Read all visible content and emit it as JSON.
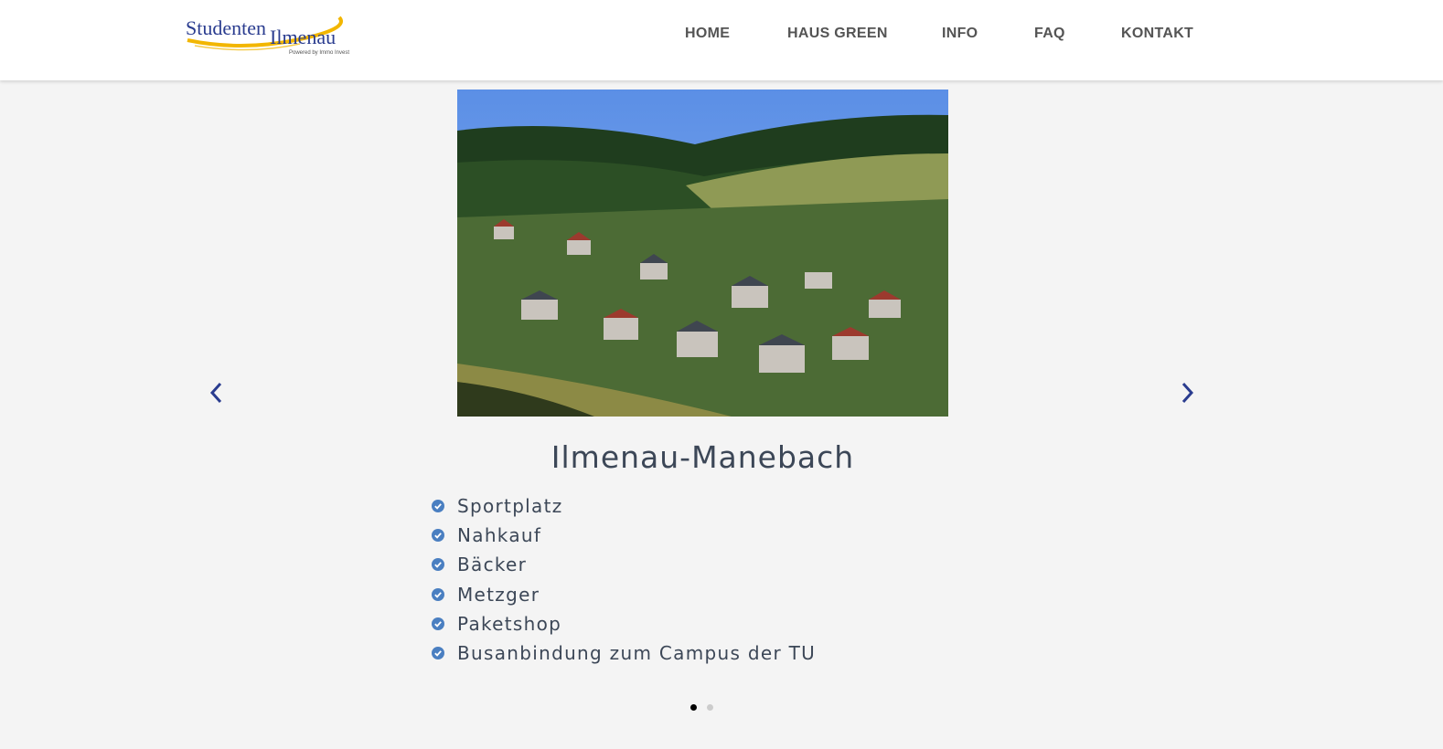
{
  "header": {
    "logo": {
      "wordmark_left": "Studenten",
      "wordmark_right": "Ilmenau",
      "tagline": "Powered by Immo Invest"
    },
    "nav": [
      {
        "label": "HOME"
      },
      {
        "label": "HAUS GREEN"
      },
      {
        "label": "INFO"
      },
      {
        "label": "FAQ"
      },
      {
        "label": "KONTAKT"
      }
    ]
  },
  "slider": {
    "image_icon": "landscape-photo",
    "title": "Ilmenau-Manebach",
    "features": [
      "Sportplatz",
      "Nahkauf",
      "Bäcker",
      "Metzger",
      "Paketshop",
      "Busanbindung zum Campus der TU"
    ],
    "prev_icon": "chevron-left-icon",
    "next_icon": "chevron-right-icon",
    "active_slide_index": 0,
    "slide_count": 2
  },
  "colors": {
    "brand_blue": "#2a3c8f",
    "brand_yellow": "#f2b600",
    "check_blue": "#4a7fc1",
    "text": "#3c4757",
    "nav_text": "#545454",
    "background": "#f4f4f4",
    "dot_active": "#000000",
    "dot_inactive": "#cccccc"
  }
}
